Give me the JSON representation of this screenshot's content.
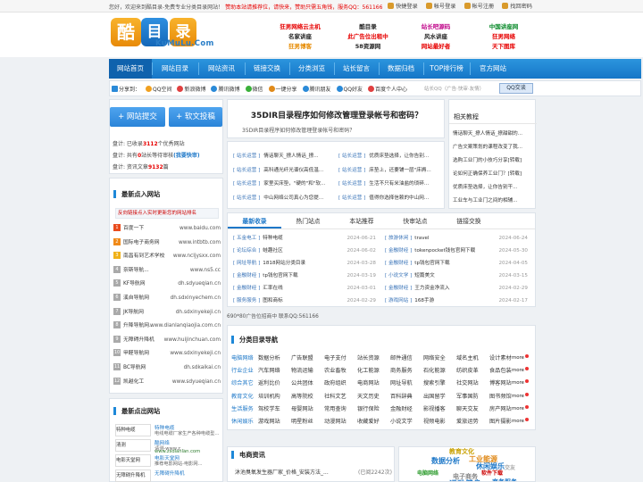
{
  "topbar": {
    "welcome": "您好，欢迎来到酷目录-免费专业分类目录网站！",
    "notice": "赞助本站请推荐位，请快来，赞助只需五角钱，服务QQ：561166",
    "links": [
      "快捷登录",
      "帐号登录",
      "帐号注册",
      "找回密码"
    ]
  },
  "logo": {
    "char1": "酷",
    "char2": "目",
    "char3": "录",
    "domain": "KuMuLu.Com"
  },
  "ads": [
    [
      "狂男网络云主机",
      "酷目录",
      "站长吧源码",
      "中国讲座网"
    ],
    [
      "名家讲座",
      "此广告位出租中",
      "风水讲座",
      "狂男网络"
    ],
    [
      "狂男博客",
      "58资源网",
      "网站最好者",
      "天下图库"
    ]
  ],
  "ad_colors": [
    [
      "#e60000",
      "#222",
      "#c0078a",
      "#0a8a2a"
    ],
    [
      "#222",
      "#e60000",
      "#222",
      "#e60000"
    ],
    [
      "#e68a00",
      "#222",
      "#e60000",
      "#e60000"
    ]
  ],
  "nav": [
    "网站首页",
    "网站目录",
    "网站资讯",
    "链接交换",
    "分类浏览",
    "站长留言",
    "数据归档",
    "TOP排行榜",
    "官方网站"
  ],
  "share": {
    "label": "分享到：",
    "items": [
      "QQ空间",
      "新浪微博",
      "腾讯微博",
      "微信",
      "一键分享",
      "腾讯朋友",
      "QQ好友",
      "百度个人中心"
    ],
    "colors": [
      "#f0a020",
      "#e04040",
      "#2a8ad8",
      "#3ab03a",
      "#e08a1a",
      "#2a8ad8",
      "#2a8ad8",
      "#e04040"
    ],
    "search_placeholder": "站长QQ（广告·快审·友情）",
    "search_button": "QQ交谈"
  },
  "buttons": {
    "submit": "+ 网站提交",
    "post": "+ 软文投稿"
  },
  "stats": {
    "l1a": "盘计: 已收录",
    "l1n": "3112",
    "l1b": "个优秀网站",
    "l2a": "盘计: 共有",
    "l2n": "0",
    "l2b": "站长等待审核",
    "l2c": "(我要快审)",
    "l3a": "盘计: 资讯文章",
    "l3n": "9132",
    "l3b": "篇"
  },
  "hot_in": {
    "title": "最新点入网站",
    "notice": "反向链接点入实时更新您的网站排名",
    "rows": [
      {
        "n": "1",
        "name": "百度一下",
        "url": "www.baidu.com"
      },
      {
        "n": "2",
        "name": "国际电子商务网",
        "url": "www.intbtb.com"
      },
      {
        "n": "3",
        "name": "南昌有到艺术学校",
        "url": "www.ncljysxx.com"
      },
      {
        "n": "4",
        "name": "奈斯导航...",
        "url": "www.ns5.cc"
      },
      {
        "n": "5",
        "name": "KF导航网",
        "url": "dh.sdyueqian.cn"
      },
      {
        "n": "6",
        "name": "溪自导航网",
        "url": "dh.sdxinyechem.cn"
      },
      {
        "n": "7",
        "name": "JK导航网",
        "url": "dh.sdxinyekeji.cn"
      },
      {
        "n": "8",
        "name": "升降导航网...",
        "url": "www.dianlanqiaojia.com.cn"
      },
      {
        "n": "9",
        "name": "无障碍升降机",
        "url": "www.huijinchuan.com"
      },
      {
        "n": "10",
        "name": "甲醛导航网",
        "url": "www.sdxinyekeji.cn"
      },
      {
        "n": "11",
        "name": "BC导航网",
        "url": "dh.sdkaikai.cn"
      },
      {
        "n": "12",
        "name": "凯越化工",
        "url": "www.sdyueqian.cn"
      }
    ],
    "num_colors": [
      "#e94c1e",
      "#f08a1a",
      "#f0b21a",
      "#aaa",
      "#aaa",
      "#aaa",
      "#aaa",
      "#aaa",
      "#aaa",
      "#aaa",
      "#aaa",
      "#aaa"
    ]
  },
  "hot_out": {
    "title": "最新点出网站",
    "items": [
      {
        "name": "特种电缆",
        "label": "特种电缆",
        "desc": "电线电缆厂家生产各种电缆型..."
      },
      {
        "name": "清测",
        "label": "酷网络",
        "desc": "请测-www.z..."
      },
      {
        "name": "电影天堂网",
        "label": "电影天堂网",
        "desc": "推荐电影网站-电影网..."
      },
      {
        "name": "无障碍升降机",
        "label": "无障碍升降机",
        "desc": ""
      }
    ],
    "url2": "www.zsdianlan.com"
  },
  "headline": {
    "title": "35DIR目录程序如何修改管理登录帐号和密码？",
    "sub": "35DIR目录程序如何修改管理登录帐号和密码？"
  },
  "news_left": [
    {
      "cat": "[ 站长运营 ]",
      "t": "情话聊天_撩人情话_撩..."
    },
    {
      "cat": "[ 站长运营 ]",
      "t": "高科通光纤光谱仪高低温..."
    },
    {
      "cat": "[ 站长运营 ]",
      "t": "家里买床垫，\"硬的\"和\"软..."
    },
    {
      "cat": "[ 站长运营 ]",
      "t": "中山网络公司真心为您提..."
    }
  ],
  "news_right": [
    {
      "cat": "[ 站长运营 ]",
      "t": "优质床垫选择，让你告别..."
    },
    {
      "cat": "[ 站长运营 ]",
      "t": "床垫上，还要铺一层\"床褥..."
    },
    {
      "cat": "[ 站长运营 ]",
      "t": "生活不只有米油盐的琐碎..."
    },
    {
      "cat": "[ 站长运营 ]",
      "t": "值得你选择信赖的中山网..."
    }
  ],
  "related": {
    "title": "相关教程",
    "items": [
      "情话聊天_撩人情话_撩甜甜的...",
      "广告文案策划的课程改变了我...",
      "选购工业门的小技巧分享[转载]",
      "论如何正确保养工业门？[转载]",
      "优质床垫选择，让你告别干...",
      "工业车与工业门之间的相辅..."
    ]
  },
  "tabs": [
    "最新收录",
    "热门站点",
    "本站推荐",
    "快审站点",
    "链接交换"
  ],
  "recent_left": [
    {
      "c": "[ 五金电工 ]",
      "t": "特种电缆",
      "d": "2024-06-21"
    },
    {
      "c": "[ 论坛综合 ]",
      "t": "蛙趣社区",
      "d": "2024-06-02"
    },
    {
      "c": "[ 网址导航 ]",
      "t": "1818网站分类目录",
      "d": "2024-03-28"
    },
    {
      "c": "[ 金融财经 ]",
      "t": "tp钱包官网下载",
      "d": "2024-03-19"
    },
    {
      "c": "[ 金融财经 ]",
      "t": "汇率在线",
      "d": "2024-03-01"
    },
    {
      "c": "[ 服务服务 ]",
      "t": "图和商标",
      "d": "2024-02-29"
    }
  ],
  "recent_right": [
    {
      "c": "[ 旅游休闲 ]",
      "t": "travel",
      "d": "2024-06-24"
    },
    {
      "c": "[ 金融财经 ]",
      "t": "tokenpocket钱包官网下载",
      "d": "2024-05-30"
    },
    {
      "c": "[ 金融财经 ]",
      "t": "tp钱包官网下载",
      "d": "2024-04-05"
    },
    {
      "c": "[ 小说文学 ]",
      "t": "短篇美文",
      "d": "2024-03-15"
    },
    {
      "c": "[ 金融财经 ]",
      "t": "王力资金净流入",
      "d": "2024-02-29"
    },
    {
      "c": "[ 游戏网站 ]",
      "t": "168手游",
      "d": "2024-02-17"
    }
  ],
  "adline": "690*80广告位招商中 联系QQ:561166",
  "category": {
    "title": "分类目录导航",
    "more": "more",
    "rows": [
      [
        "电脑网络",
        "数据分析",
        "广告联盟",
        "电子支付",
        "站长资源",
        "邮件通信",
        "网络安全",
        "域名主机",
        "设计素材"
      ],
      [
        "行业企业",
        "汽车网络",
        "物流运输",
        "农业畜牧",
        "化工能源",
        "商务服务",
        "石化能源",
        "纺织皮革",
        "食品包装"
      ],
      [
        "综合其它",
        "返利比价",
        "公共团体",
        "政府组织",
        "电商网站",
        "网址导航",
        "搜索引擎",
        "社交网站",
        "博客网站"
      ],
      [
        "教育文化",
        "培训机构",
        "高等院校",
        "社科文艺",
        "天文历史",
        "百科辞典",
        "出国留学",
        "军事国防",
        "图书频馆"
      ],
      [
        "生活服务",
        "驾校学车",
        "母婴网站",
        "常用查询",
        "银行保险",
        "金融财经",
        "影视播客",
        "聊天交友",
        "房产网站"
      ],
      [
        "休闲娱乐",
        "游戏网站",
        "明星粉丝",
        "动漫网站",
        "收藏爱好",
        "小说文学",
        "视频电影",
        "爱旅运势",
        "图片摄影"
      ]
    ]
  },
  "info": {
    "title": "电商资讯",
    "item": "沐池臭氧发生器厂家_价格_安装方法_...",
    "views": "(已阅2242次)"
  },
  "tagcloud": [
    "教育文化",
    "数据分析",
    "工业能源",
    "休闲娱乐",
    "电脑网络",
    "软件下载",
    "电子商务",
    "交友",
    "运动健身",
    "商务服务"
  ]
}
